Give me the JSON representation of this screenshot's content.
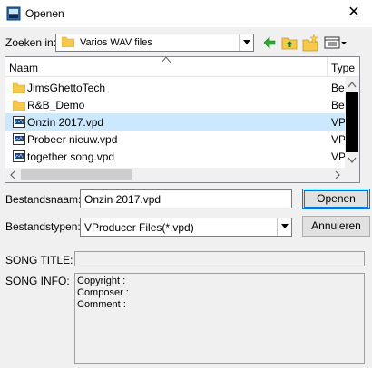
{
  "window": {
    "title": "Openen",
    "close_glyph": "✕"
  },
  "lookin": {
    "label": "Zoeken in:",
    "value": "Varios WAV files"
  },
  "toolbar_icons": [
    "back-arrow-icon",
    "up-folder-icon",
    "new-folder-icon",
    "view-menu-icon"
  ],
  "filelist": {
    "columns": [
      "Naam",
      "Type"
    ],
    "rows": [
      {
        "name": "JimsGhettoTech",
        "type": "Bestan",
        "icon": "folder-icon",
        "selected": false
      },
      {
        "name": "R&B_Demo",
        "type": "Bestan",
        "icon": "folder-icon",
        "selected": false
      },
      {
        "name": "Onzin 2017.vpd",
        "type": "VPD-b",
        "icon": "vpd-file-icon",
        "selected": true
      },
      {
        "name": "Probeer nieuw.vpd",
        "type": "VPD-b",
        "icon": "vpd-file-icon",
        "selected": false
      },
      {
        "name": "together song.vpd",
        "type": "VPD-b",
        "icon": "vpd-file-icon",
        "selected": false
      }
    ]
  },
  "filename": {
    "label": "Bestandsnaam:",
    "value": "Onzin 2017.vpd"
  },
  "filetype": {
    "label": "Bestandstypen:",
    "value": "VProducer Files(*.vpd)"
  },
  "buttons": {
    "open": "Openen",
    "cancel": "Annuleren"
  },
  "song": {
    "title_label": "SONG TITLE:",
    "title_value": "",
    "info_label": "SONG INFO:",
    "info_lines": [
      "Copyright :",
      "Composer :",
      "Comment :"
    ]
  },
  "colors": {
    "selection": "#cce8ff",
    "accent": "#0078d7",
    "folder": "#f6c94a"
  }
}
